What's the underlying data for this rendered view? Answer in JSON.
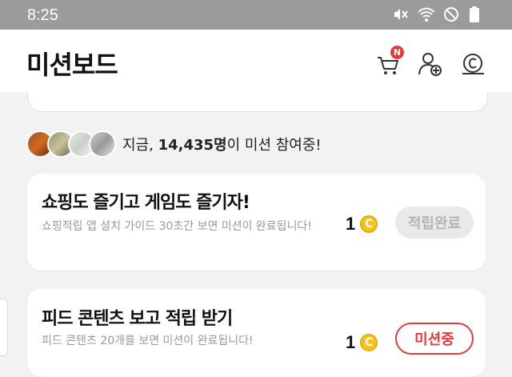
{
  "status": {
    "time": "8:25",
    "icons": [
      "mute-icon",
      "wifi-icon",
      "dnd-icon",
      "battery-icon"
    ]
  },
  "header": {
    "title": "미션보드",
    "cart_badge": "N",
    "icons": [
      "cart-icon",
      "add-user-icon",
      "coin-history-icon"
    ]
  },
  "participants": {
    "prefix": "지금, ",
    "count": "14,435명",
    "suffix": "이 미션 참여중!"
  },
  "missions": [
    {
      "title": "쇼핑도 즐기고 게임도 즐기자!",
      "desc": "쇼핑적립 앱 설치 가이드 30초간 보면 미션이 완료됩니다!",
      "reward": "1",
      "coin_symbol": "C",
      "button": "적립완료",
      "state": "done"
    },
    {
      "title": "피드 콘텐츠 보고 적립 받기",
      "desc": "피드 콘텐츠 20개를 보면 미션이 완료됩니다!",
      "reward": "1",
      "coin_symbol": "C",
      "button": "미션중",
      "state": "active"
    }
  ],
  "colors": {
    "accent": "#e53b3b",
    "coin": "#f5c518",
    "statusbar": "#9b9b9b"
  }
}
